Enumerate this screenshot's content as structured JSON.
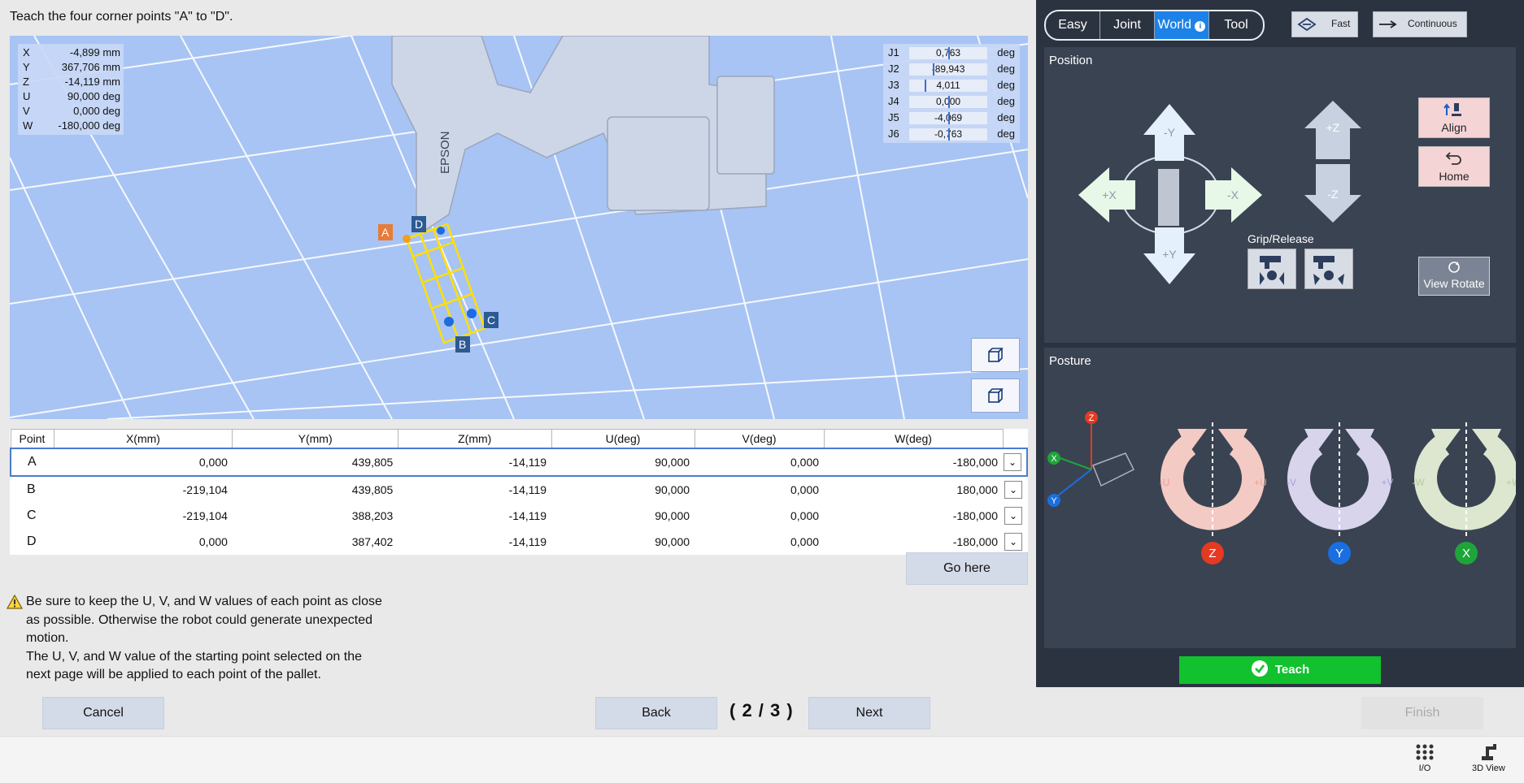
{
  "instruction": "Teach the four corner points \"A\" to \"D\".",
  "coords": [
    {
      "k": "X",
      "v": "-4,899 mm"
    },
    {
      "k": "Y",
      "v": "367,706 mm"
    },
    {
      "k": "Z",
      "v": "-14,119 mm"
    },
    {
      "k": "U",
      "v": "90,000 deg"
    },
    {
      "k": "V",
      "v": "0,000 deg"
    },
    {
      "k": "W",
      "v": "-180,000 deg"
    }
  ],
  "joints": [
    {
      "k": "J1",
      "v": "0,763",
      "unit": "deg"
    },
    {
      "k": "J2",
      "v": "-89,943",
      "unit": "deg"
    },
    {
      "k": "J3",
      "v": "4,011",
      "unit": "deg"
    },
    {
      "k": "J4",
      "v": "0,000",
      "unit": "deg"
    },
    {
      "k": "J5",
      "v": "-4,069",
      "unit": "deg"
    },
    {
      "k": "J6",
      "v": "-0,763",
      "unit": "deg"
    }
  ],
  "robot_brand": "EPSON",
  "point_labels": [
    "A",
    "B",
    "C",
    "D"
  ],
  "table": {
    "headers": [
      "Point",
      "X(mm)",
      "Y(mm)",
      "Z(mm)",
      "U(deg)",
      "V(deg)",
      "W(deg)"
    ],
    "rows": [
      {
        "point": "A",
        "x": "0,000",
        "y": "439,805",
        "z": "-14,119",
        "u": "90,000",
        "v": "0,000",
        "w": "-180,000"
      },
      {
        "point": "B",
        "x": "-219,104",
        "y": "439,805",
        "z": "-14,119",
        "u": "90,000",
        "v": "0,000",
        "w": "180,000"
      },
      {
        "point": "C",
        "x": "-219,104",
        "y": "388,203",
        "z": "-14,119",
        "u": "90,000",
        "v": "0,000",
        "w": "-180,000"
      },
      {
        "point": "D",
        "x": "0,000",
        "y": "387,402",
        "z": "-14,119",
        "u": "90,000",
        "v": "0,000",
        "w": "-180,000"
      }
    ],
    "selected_row": "A"
  },
  "go_here": "Go here",
  "warning": {
    "line1": "Be sure to keep the U, V, and W values of each point as close",
    "line2": "as possible. Otherwise the robot could generate unexpected",
    "line3": "motion.",
    "line4": "The U, V, and W value of the starting point selected on the",
    "line5": "next page will be applied to each point of the pallet."
  },
  "nav": {
    "cancel": "Cancel",
    "back": "Back",
    "page": "( 2 / 3 )",
    "next": "Next",
    "finish": "Finish"
  },
  "footer": {
    "io": "I/O",
    "view3d": "3D View"
  },
  "modes": {
    "easy": "Easy",
    "joint": "Joint",
    "world": "World",
    "tool": "Tool",
    "active": "World"
  },
  "speed": {
    "fast": "Fast",
    "continuous": "Continuous"
  },
  "position": {
    "title": "Position",
    "minus_y": "-Y",
    "plus_y": "+Y",
    "plus_x": "+X",
    "minus_x": "-X",
    "plus_z": "+Z",
    "minus_z": "-Z",
    "align": "Align",
    "home": "Home",
    "grip_release": "Grip/Release",
    "view_rotate": "View Rotate"
  },
  "posture": {
    "title": "Posture",
    "u_minus": "-U",
    "u_plus": "+U",
    "u_axis": "Z",
    "v_minus": "-V",
    "v_plus": "+V",
    "v_axis": "Y",
    "w_minus": "-W",
    "w_plus": "+W",
    "w_axis": "X",
    "triad": {
      "z": "Z",
      "x": "X",
      "y": "Y"
    }
  },
  "teach": "Teach",
  "colors": {
    "viewport_bg": "#a8c4f4",
    "panel_bg": "#2c3340",
    "section_bg": "#3a4352",
    "active_mode": "#1c82e8",
    "teach_green": "#12c12e",
    "u_ring": "#f4cac4",
    "v_ring": "#d8d4ec",
    "w_ring": "#dde6cf",
    "z_axis": "#e53922",
    "y_axis": "#1a6fe0",
    "x_axis": "#1ea53a"
  }
}
